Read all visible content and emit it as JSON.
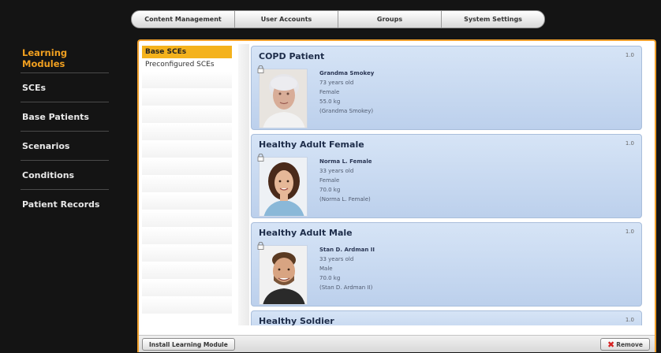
{
  "topnav": {
    "tabs": [
      "Content Management",
      "User Accounts",
      "Groups",
      "System Settings"
    ]
  },
  "sidebar": {
    "items": [
      {
        "label": "Learning Modules",
        "active": true
      },
      {
        "label": "SCEs",
        "active": false
      },
      {
        "label": "Base Patients",
        "active": false
      },
      {
        "label": "Scenarios",
        "active": false
      },
      {
        "label": "Conditions",
        "active": false
      },
      {
        "label": "Patient Records",
        "active": false
      }
    ]
  },
  "subnav": {
    "items": [
      "Base SCEs",
      "Preconfigured SCEs"
    ]
  },
  "cards": [
    {
      "title": "COPD Patient",
      "version": "1.0",
      "name": "Grandma Smokey",
      "age": "73 years old",
      "sex": "Female",
      "weight": "55.0 kg",
      "alias": "(Grandma Smokey)"
    },
    {
      "title": "Healthy Adult Female",
      "version": "1.0",
      "name": "Norma L. Female",
      "age": "33 years old",
      "sex": "Female",
      "weight": "70.0 kg",
      "alias": "(Norma L. Female)"
    },
    {
      "title": "Healthy Adult Male",
      "version": "1.0",
      "name": "Stan D. Ardman II",
      "age": "33 years old",
      "sex": "Male",
      "weight": "70.0 kg",
      "alias": "(Stan D. Ardman II)"
    },
    {
      "title": "Healthy Soldier",
      "version": "1.0"
    }
  ],
  "bottombar": {
    "install_label": "Install Learning Module",
    "remove_label": "Remove"
  }
}
